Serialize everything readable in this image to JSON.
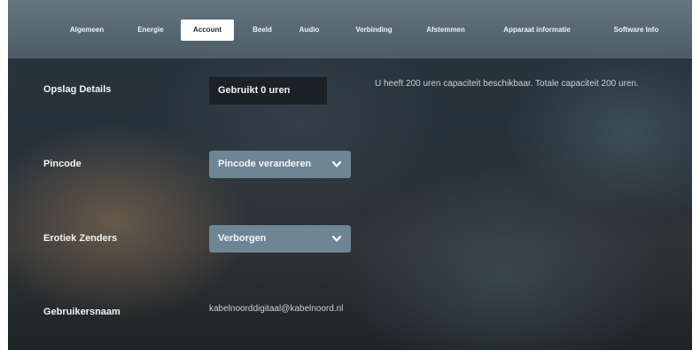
{
  "tabs": [
    {
      "label": "Algemeen",
      "active": false
    },
    {
      "label": "Energie",
      "active": false
    },
    {
      "label": "Account",
      "active": true
    },
    {
      "label": "Beeld",
      "active": false
    },
    {
      "label": "Audio",
      "active": false
    },
    {
      "label": "Verbinding",
      "active": false
    },
    {
      "label": "Afstemmen",
      "active": false
    },
    {
      "label": "Apparaat informatie",
      "active": false
    },
    {
      "label": "Software Info",
      "active": false
    }
  ],
  "storage": {
    "label": "Opslag Details",
    "value": "Gebruikt 0 uren",
    "info": "U heeft 200 uren capaciteit beschikbaar. Totale capaciteit 200 uren."
  },
  "pincode": {
    "label": "Pincode",
    "dropdown_value": "Pincode veranderen"
  },
  "erotic": {
    "label": "Erotiek Zenders",
    "dropdown_value": "Verborgen"
  },
  "username": {
    "label": "Gebruikersnaam",
    "value": "kabelnoorddigitaal@kabelnoord.nl"
  },
  "colors": {
    "active_tab_bg": "#ffffff",
    "dropdown_bg": "#6e8594",
    "value_box_bg": "#1c2125",
    "label_text": "#f1f4f6",
    "info_text": "#c9d2d8"
  },
  "icons": {
    "dropdown": "chevron-down-icon"
  }
}
